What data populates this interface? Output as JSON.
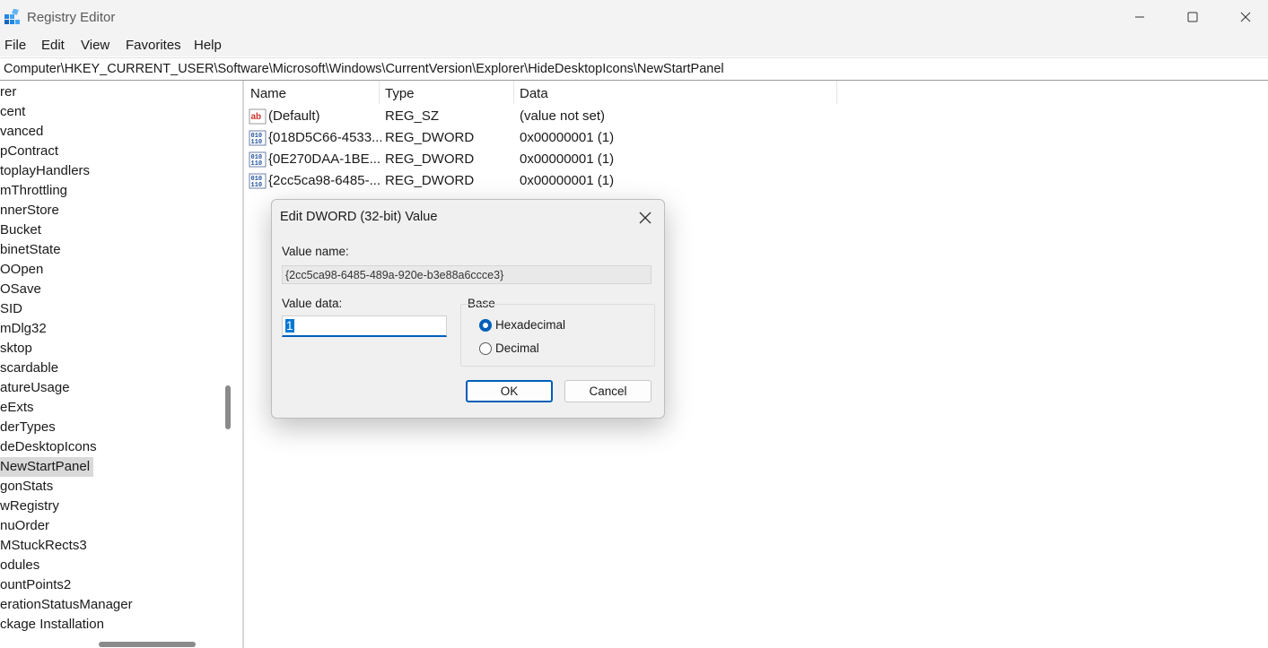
{
  "window": {
    "title": "Registry Editor"
  },
  "menu": [
    "File",
    "Edit",
    "View",
    "Favorites",
    "Help"
  ],
  "address": "Computer\\HKEY_CURRENT_USER\\Software\\Microsoft\\Windows\\CurrentVersion\\Explorer\\HideDesktopIcons\\NewStartPanel",
  "tree": {
    "items": [
      "rer",
      "cent",
      "vanced",
      "pContract",
      "toplayHandlers",
      "mThrottling",
      "nnerStore",
      "Bucket",
      "binetState",
      "OOpen",
      "OSave",
      "SID",
      "mDlg32",
      "sktop",
      "scardable",
      "atureUsage",
      "eExts",
      "derTypes",
      "deDesktopIcons",
      "NewStartPanel",
      "gonStats",
      "wRegistry",
      "nuOrder",
      "MStuckRects3",
      "odules",
      "ountPoints2",
      "erationStatusManager",
      "ckage Installation"
    ],
    "selected": "NewStartPanel"
  },
  "list": {
    "headers": [
      "Name",
      "Type",
      "Data"
    ],
    "rows": [
      {
        "icon": "string-value-icon",
        "name": "(Default)",
        "type": "REG_SZ",
        "data": "(value not set)"
      },
      {
        "icon": "binary-value-icon",
        "name": "{018D5C66-4533...",
        "type": "REG_DWORD",
        "data": "0x00000001 (1)"
      },
      {
        "icon": "binary-value-icon",
        "name": "{0E270DAA-1BE...",
        "type": "REG_DWORD",
        "data": "0x00000001 (1)"
      },
      {
        "icon": "binary-value-icon",
        "name": "{2cc5ca98-6485-...",
        "type": "REG_DWORD",
        "data": "0x00000001 (1)"
      }
    ]
  },
  "dialog": {
    "title": "Edit DWORD (32-bit) Value",
    "value_name_label": "Value name:",
    "value_name": "{2cc5ca98-6485-489a-920e-b3e88a6ccce3}",
    "value_data_label": "Value data:",
    "value_data": "1",
    "base_label": "Base",
    "base_options": [
      {
        "label": "Hexadecimal",
        "checked": true
      },
      {
        "label": "Decimal",
        "checked": false
      }
    ],
    "ok_label": "OK",
    "cancel_label": "Cancel"
  },
  "colors": {
    "accent": "#005fb8",
    "selection": "#d9d9d9",
    "chrome": "#f3f3f3"
  }
}
